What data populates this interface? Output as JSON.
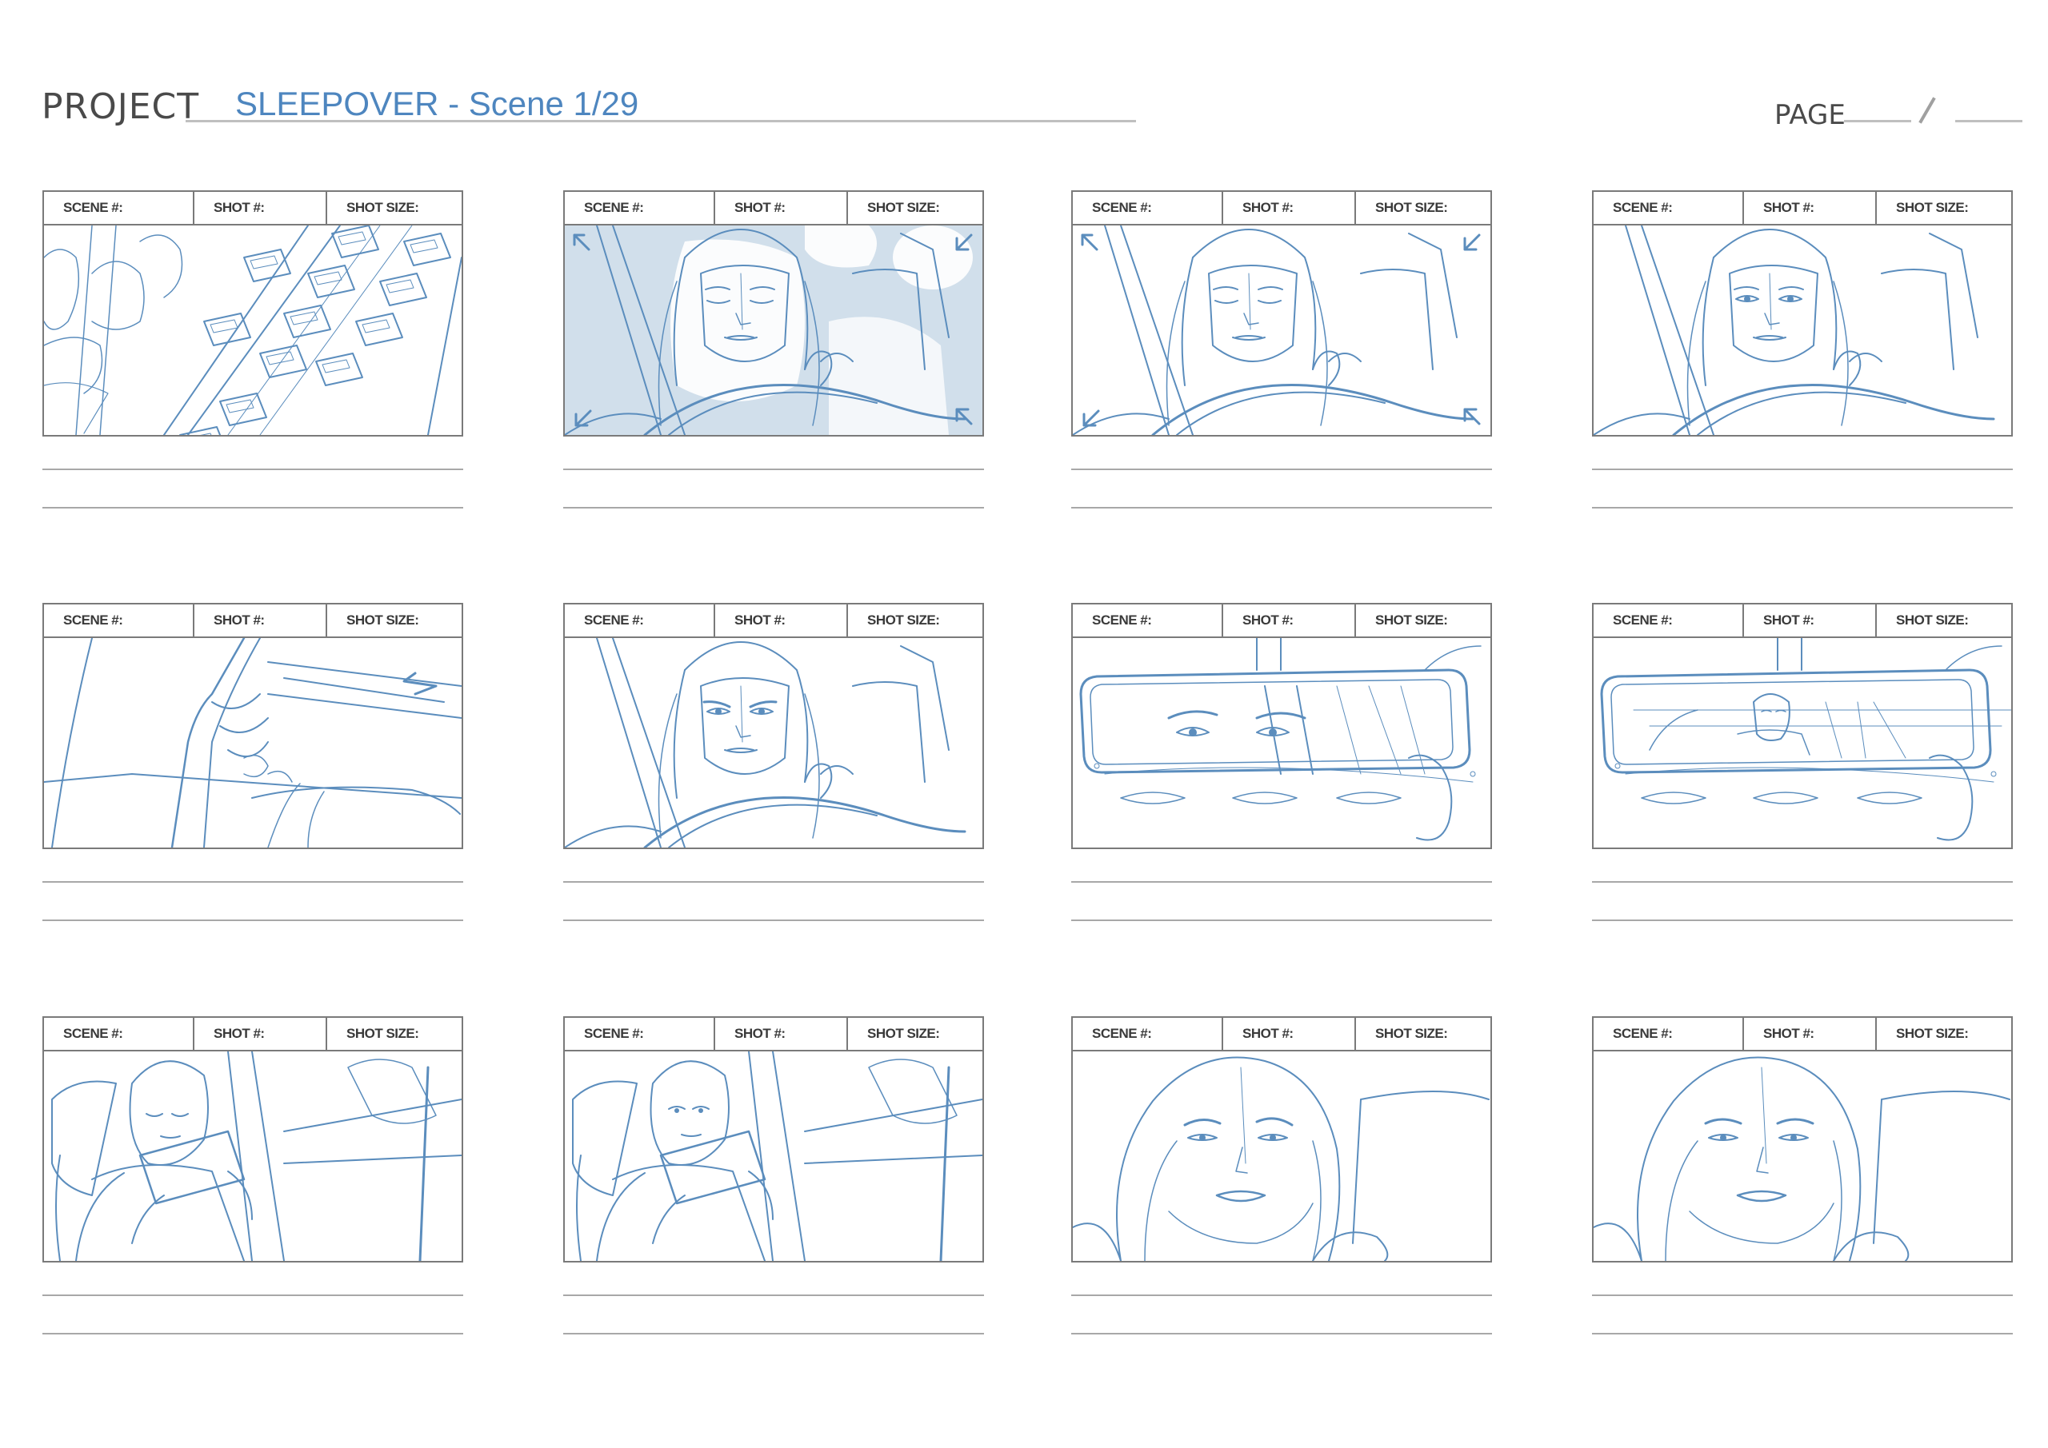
{
  "header": {
    "project_label": "PROJECT",
    "project_title": "SLEEPOVER - Scene 1/29",
    "page_label": "PAGE"
  },
  "panel_labels": {
    "scene": "SCENE #:",
    "shot": "SHOT #:",
    "shot_size": "SHOT SIZE:"
  },
  "panels": [
    {
      "sketch": "highway-traffic-aerial"
    },
    {
      "sketch": "woman-driving-eyes-closed-blue-wash"
    },
    {
      "sketch": "woman-driving-eyes-closed"
    },
    {
      "sketch": "woman-driving-eyes-open"
    },
    {
      "sketch": "foot-on-pedal-closeup"
    },
    {
      "sketch": "woman-driving-frowning"
    },
    {
      "sketch": "rearview-mirror-eyes"
    },
    {
      "sketch": "rearview-mirror-boy-reflection"
    },
    {
      "sketch": "boy-playing-handheld-game"
    },
    {
      "sketch": "boy-looking-up-from-game"
    },
    {
      "sketch": "woman-closeup-pursed-lips"
    },
    {
      "sketch": "woman-closeup-serious"
    }
  ],
  "colors": {
    "sketch_line": "#5b8dbd",
    "wash": "#c9d9e8",
    "frame": "#7a7a7a",
    "title": "#4e86bf"
  }
}
